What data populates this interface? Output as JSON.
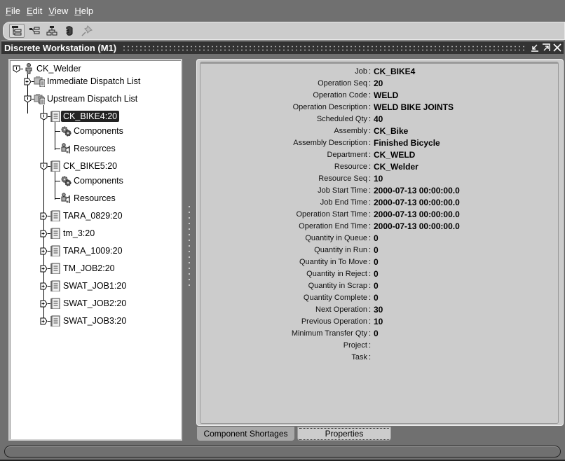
{
  "menu": [
    {
      "label": "File",
      "mnemonic": "F",
      "rest": "ile"
    },
    {
      "label": "Edit",
      "mnemonic": "E",
      "rest": "dit"
    },
    {
      "label": "View",
      "mnemonic": "V",
      "rest": "iew"
    },
    {
      "label": "Help",
      "mnemonic": "H",
      "rest": "elp"
    }
  ],
  "toolbar": {
    "buttons": [
      "tree-view-icon",
      "expand-tree-icon",
      "hierarchy-icon",
      "hand-icon",
      "pin-icon"
    ]
  },
  "window": {
    "title": "Discrete Workstation (M1)",
    "controls": [
      "minimize-icon",
      "maximize-icon",
      "close-icon"
    ]
  },
  "tree": {
    "root": "CK_Welder",
    "immediate": "Immediate Dispatch List",
    "upstream": "Upstream Dispatch List",
    "jobs": [
      {
        "label": "CK_BIKE4:20",
        "expanded": true,
        "selected": true,
        "children": [
          "Components",
          "Resources"
        ]
      },
      {
        "label": "CK_BIKE5:20",
        "expanded": true,
        "selected": false,
        "children": [
          "Components",
          "Resources"
        ]
      },
      {
        "label": "TARA_0829:20",
        "expanded": false
      },
      {
        "label": "tm_3:20",
        "expanded": false
      },
      {
        "label": "TARA_1009:20",
        "expanded": false
      },
      {
        "label": "TM_JOB2:20",
        "expanded": false
      },
      {
        "label": "SWAT_JOB1:20",
        "expanded": false
      },
      {
        "label": "SWAT_JOB2:20",
        "expanded": false
      },
      {
        "label": "SWAT_JOB3:20",
        "expanded": false
      }
    ]
  },
  "properties": [
    {
      "label": "Job",
      "value": "CK_BIKE4"
    },
    {
      "label": "Operation Seq",
      "value": "20"
    },
    {
      "label": "Operation Code",
      "value": "WELD"
    },
    {
      "label": "Operation Description",
      "value": "WELD BIKE JOINTS"
    },
    {
      "label": "Scheduled Qty",
      "value": "40"
    },
    {
      "label": "Assembly",
      "value": "CK_Bike"
    },
    {
      "label": "Assembly Description",
      "value": "Finished Bicycle"
    },
    {
      "label": "Department",
      "value": "CK_WELD"
    },
    {
      "label": "Resource",
      "value": "CK_Welder"
    },
    {
      "label": "Resource Seq",
      "value": "10"
    },
    {
      "label": "Job Start Time",
      "value": "2000-07-13 00:00:00.0"
    },
    {
      "label": "Job End Time",
      "value": "2000-07-13 00:00:00.0"
    },
    {
      "label": "Operation Start Time",
      "value": "2000-07-13 00:00:00.0"
    },
    {
      "label": "Operation End Time",
      "value": "2000-07-13 00:00:00.0"
    },
    {
      "label": "Quantity in Queue",
      "value": "0"
    },
    {
      "label": "Quantity in Run",
      "value": "0"
    },
    {
      "label": "Quantity in To Move",
      "value": "0"
    },
    {
      "label": "Quantity in Reject",
      "value": "0"
    },
    {
      "label": "Quantity in Scrap",
      "value": "0"
    },
    {
      "label": "Quantity Complete",
      "value": "0"
    },
    {
      "label": "Next Operation",
      "value": "30"
    },
    {
      "label": "Previous Operation",
      "value": "10"
    },
    {
      "label": "Minimum Transfer Qty",
      "value": "0"
    },
    {
      "label": "Project",
      "value": ""
    },
    {
      "label": "Task",
      "value": ""
    }
  ],
  "tabs": [
    {
      "label": "Component Shortages",
      "active": false
    },
    {
      "label": "Properties",
      "active": true
    }
  ],
  "separator": ":"
}
